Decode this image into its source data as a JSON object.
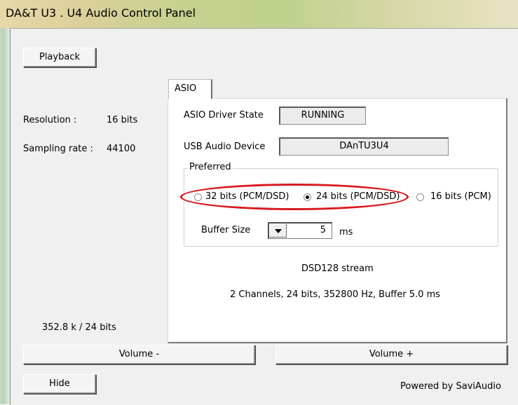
{
  "window": {
    "title": "DA&T  U3 . U4  Audio Control Panel"
  },
  "buttons": {
    "playback": "Playback",
    "volume_down": "Volume -",
    "volume_up": "Volume +",
    "hide": "Hide"
  },
  "status": {
    "resolution_label": "Resolution :",
    "resolution_value": "16 bits",
    "sampling_label": "Sampling rate :",
    "sampling_value": "44100",
    "rate_summary": "352.8 k / 24 bits"
  },
  "tabs": [
    {
      "label": "ASIO",
      "selected": true
    }
  ],
  "asio": {
    "driver_state_label": "ASIO Driver State",
    "driver_state_value": "RUNNING",
    "usb_device_label": "USB Audio Device",
    "usb_device_value": "DAnTU3U4",
    "preferred_label": "Preferred",
    "options": [
      {
        "label": "32 bits (PCM/DSD)",
        "checked": false
      },
      {
        "label": "24 bits (PCM/DSD)",
        "checked": true
      },
      {
        "label": "16 bits (PCM)",
        "checked": false
      }
    ],
    "buffer_size_label": "Buffer Size",
    "buffer_size_value": "5",
    "buffer_unit": "ms",
    "stream_text": "DSD128 stream",
    "stream_info": "2 Channels, 24 bits, 352800 Hz, Buffer 5.0 ms"
  },
  "footer": {
    "powered_by": "Powered by SaviAudio"
  },
  "colors": {
    "highlight_ellipse": "#d8191f"
  }
}
